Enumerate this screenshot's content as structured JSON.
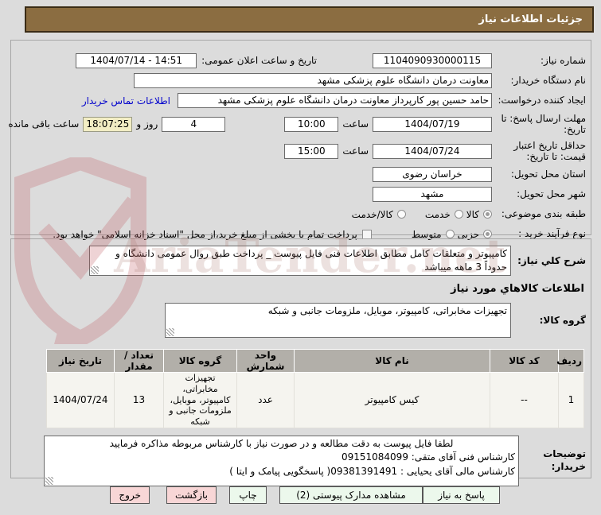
{
  "page_title": "جزئیات اطلاعات نیاز",
  "watermark": {
    "text": "AriaTender.net"
  },
  "colors": {
    "titlebar_bg": "#8b6d41",
    "page_bg": "#dcdcdc",
    "countdown_bg": "#f2edc4",
    "table_header_bg": "#b2afa9",
    "button_green_bg": "#ecf8ec",
    "button_pink_bg": "#f8d6d6",
    "link_blue": "#0000cc"
  },
  "form": {
    "need_number": {
      "label": "شماره نیاز:",
      "value": "1104090930000115"
    },
    "announce_datetime": {
      "label": "تاریخ و ساعت اعلان عمومی:",
      "value": "1404/07/14 - 14:51"
    },
    "buyer_org": {
      "label": "نام دستگاه خریدار:",
      "value": "معاونت درمان دانشگاه علوم پزشکی مشهد"
    },
    "request_creator": {
      "label": "ایجاد کننده درخواست:",
      "value": "حامد حسین پور کارپرداز معاونت درمان دانشگاه علوم پزشکی مشهد",
      "contact_link": "اطلاعات تماس خریدار"
    },
    "response_deadline": {
      "label": "مهلت ارسال پاسخ: تا تاریخ:",
      "date": "1404/07/19",
      "hour_label": "ساعت",
      "time": "10:00",
      "days_remaining": "4",
      "days_label": "روز و",
      "countdown": "18:07:25",
      "remaining_label": "ساعت باقی مانده"
    },
    "price_validity": {
      "label": "حداقل تاریخ اعتبار قیمت: تا تاریخ:",
      "date": "1404/07/24",
      "hour_label": "ساعت",
      "time": "15:00"
    },
    "delivery_province": {
      "label": "استان محل تحویل:",
      "value": "خراسان رضوی"
    },
    "delivery_city": {
      "label": "شهر محل تحویل:",
      "value": "مشهد"
    },
    "subject_class": {
      "label": "طبقه بندی موضوعی:",
      "options": [
        "کالا",
        "خدمت",
        "کالا/خدمت"
      ],
      "selected": "کالا"
    },
    "purchase_process": {
      "label": "نوع فرآیند خرید :",
      "options": [
        "جزیی",
        "متوسط"
      ],
      "selected": "جزیی",
      "treasury_note": "پرداخت تمام یا بخشی از مبلغ خرید،از محل \"اسناد خزانه اسلامی\" خواهد بود."
    }
  },
  "need_description": {
    "label": "شرح کلي نیاز:",
    "value": "کامپیوتر و متعلقات کامل مطابق اطلاعات فنی فایل پیوست _ پرداخت طبق روال عمومی دانشگاه و حدوداً 3 ماهه میباشد"
  },
  "goods_section": {
    "title": "اطلاعات کالاهاي مورد نیاز",
    "group_label": "گروه کالا:",
    "group_value": "تجهیزات مخابراتی، کامپیوتر، موبایل، ملزومات جانبی و شبکه",
    "table": {
      "headers": [
        "ردیف",
        "کد کالا",
        "نام کالا",
        "واحد شمارش",
        "گروه کالا",
        "تعداد / مقدار",
        "تاریخ نیاز"
      ],
      "rows": [
        [
          "1",
          "--",
          "کیس کامپیوتر",
          "عدد",
          "تجهیزات مخابراتی، کامپیوتر، موبایل، ملزومات جانبی و شبکه",
          "13",
          "1404/07/24"
        ]
      ]
    }
  },
  "buyer_notes": {
    "label": "توضیحات خریدار:",
    "lines": [
      "لطفا فایل پیوست به دقت مطالعه و در صورت نیاز با کارشناس مربوطه مذاکره فرمایید",
      "کارشناس فنی آقای متقی: 09151084099",
      "کارشناس مالی آقای یحیایی :   09381391491( پاسخگویی پیامک و ایتا )"
    ]
  },
  "buttons": [
    {
      "id": "respond",
      "label": "پاسخ به نیاز",
      "type": "green"
    },
    {
      "id": "view-docs",
      "label": "مشاهده مدارک پیوستی (2)",
      "type": "green"
    },
    {
      "id": "print",
      "label": "چاپ",
      "type": "green"
    },
    {
      "id": "back",
      "label": "بازگشت",
      "type": "pink"
    },
    {
      "id": "exit",
      "label": "خروج",
      "type": "pink"
    }
  ]
}
